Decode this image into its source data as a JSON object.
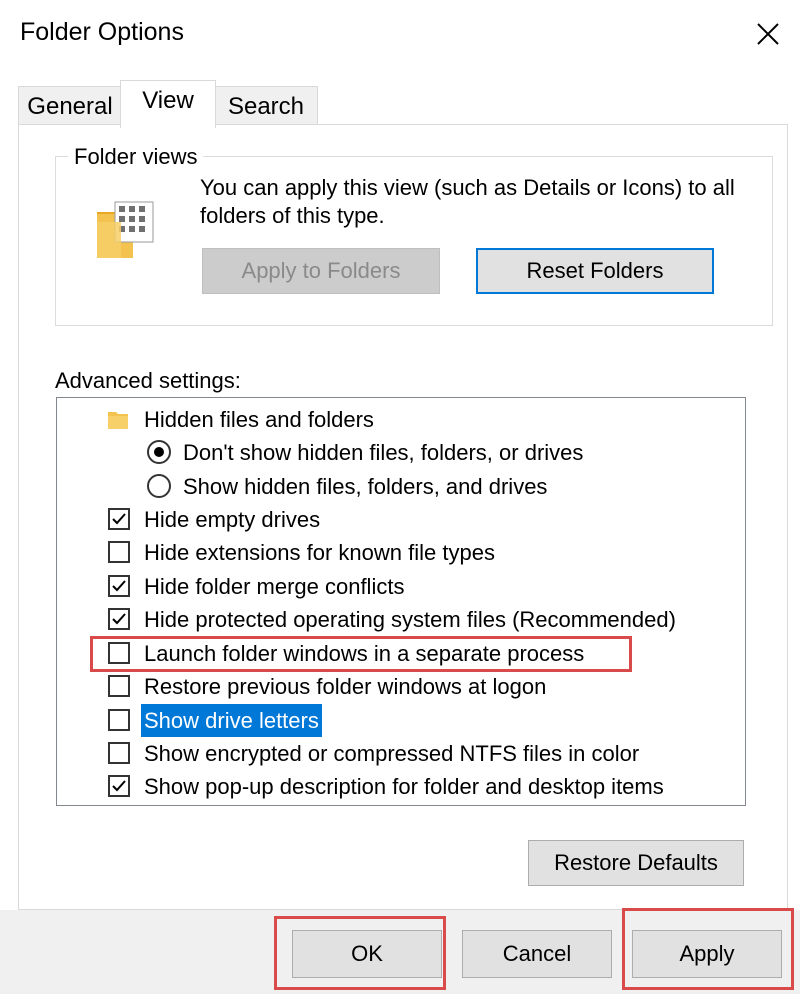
{
  "window": {
    "title": "Folder Options"
  },
  "tabs": [
    {
      "label": "General",
      "active": false
    },
    {
      "label": "View",
      "active": true
    },
    {
      "label": "Search",
      "active": false
    }
  ],
  "folder_views": {
    "title": "Folder views",
    "description": "You can apply this view (such as Details or Icons) to all folders of this type.",
    "apply_label": "Apply to Folders",
    "reset_label": "Reset Folders"
  },
  "advanced": {
    "label": "Advanced settings:",
    "items": [
      {
        "type": "folder",
        "label": "Hidden files and folders"
      },
      {
        "type": "radio",
        "label": "Don't show hidden files, folders, or drives",
        "checked": true
      },
      {
        "type": "radio",
        "label": "Show hidden files, folders, and drives",
        "checked": false
      },
      {
        "type": "checkbox",
        "label": "Hide empty drives",
        "checked": true
      },
      {
        "type": "checkbox",
        "label": "Hide extensions for known file types",
        "checked": false
      },
      {
        "type": "checkbox",
        "label": "Hide folder merge conflicts",
        "checked": true
      },
      {
        "type": "checkbox",
        "label": "Hide protected operating system files (Recommended)",
        "checked": true
      },
      {
        "type": "checkbox",
        "label": "Launch folder windows in a separate process",
        "checked": false,
        "highlighted": true
      },
      {
        "type": "checkbox",
        "label": "Restore previous folder windows at logon",
        "checked": false
      },
      {
        "type": "checkbox",
        "label": "Show drive letters",
        "checked": false,
        "selected": true
      },
      {
        "type": "checkbox",
        "label": "Show encrypted or compressed NTFS files in color",
        "checked": false
      },
      {
        "type": "checkbox",
        "label": "Show pop-up description for folder and desktop items",
        "checked": true
      }
    ],
    "restore_defaults_label": "Restore Defaults"
  },
  "buttons": {
    "ok": "OK",
    "cancel": "Cancel",
    "apply": "Apply"
  },
  "colors": {
    "accent": "#0078d7",
    "highlight": "#d94a4a",
    "folder": "#f4c24e"
  }
}
